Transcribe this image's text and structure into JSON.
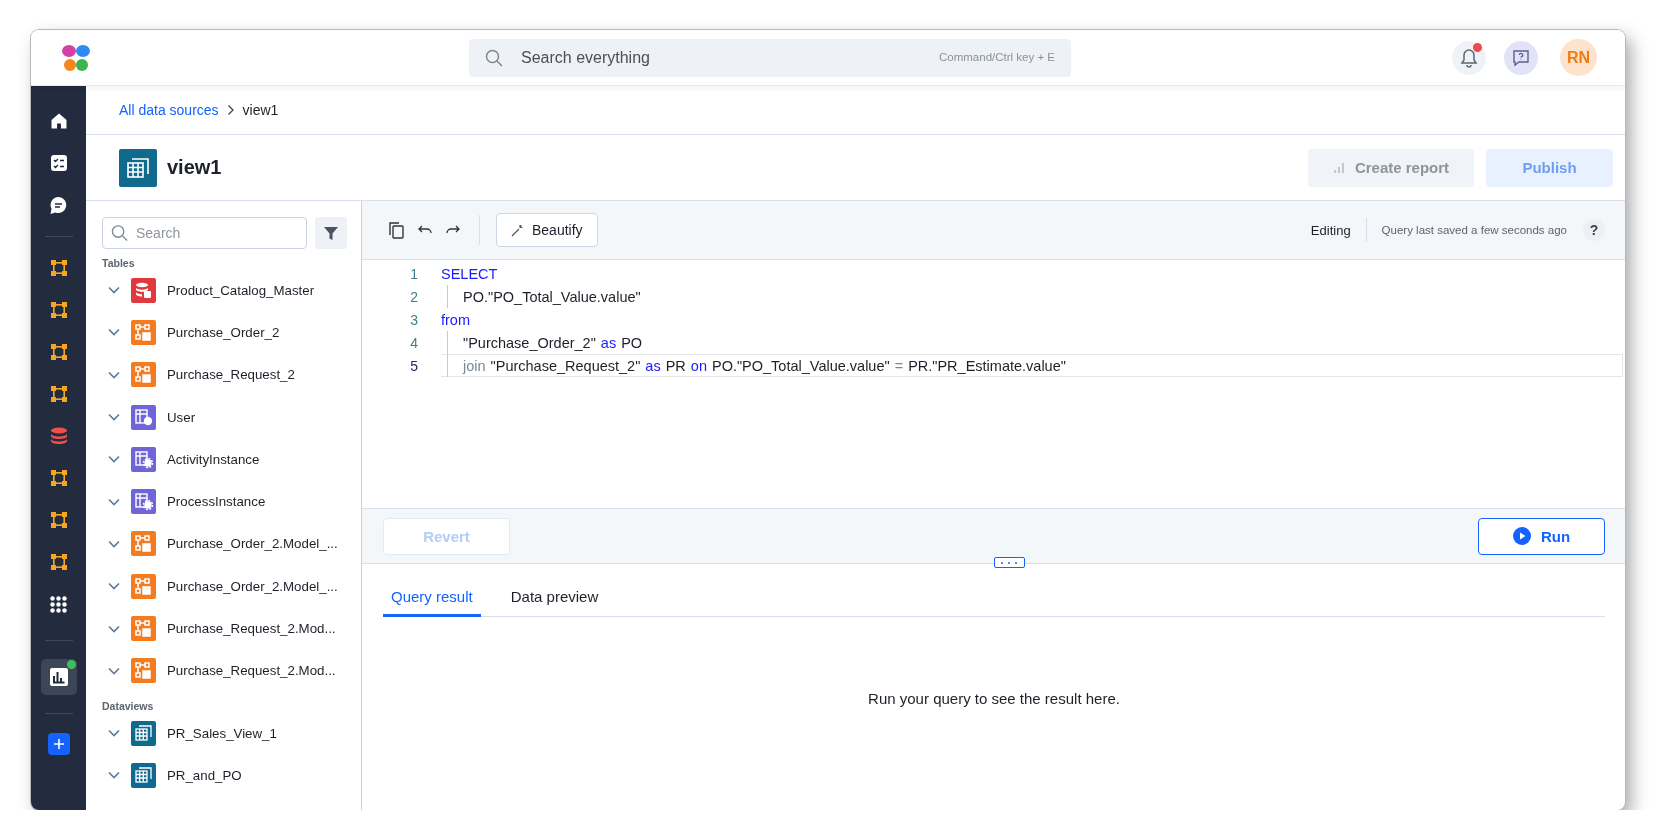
{
  "topbar": {
    "search": {
      "placeholder": "Search everything",
      "shortcut": "Command/Ctrl key + E"
    },
    "notifications": {
      "unread": true
    },
    "avatar": {
      "initials": "RN"
    }
  },
  "rail": [
    [
      {
        "kind": "home",
        "selected": false,
        "dot": false
      },
      {
        "kind": "tasks",
        "selected": false,
        "dot": false
      },
      {
        "kind": "chat",
        "selected": false,
        "dot": false
      }
    ],
    [
      {
        "kind": "model",
        "selected": false,
        "dot": false
      },
      {
        "kind": "model",
        "selected": false,
        "dot": false
      },
      {
        "kind": "model",
        "selected": false,
        "dot": false
      },
      {
        "kind": "model",
        "selected": false,
        "dot": false
      },
      {
        "kind": "database",
        "selected": false,
        "dot": false
      },
      {
        "kind": "model",
        "selected": false,
        "dot": false
      },
      {
        "kind": "model",
        "selected": false,
        "dot": false
      },
      {
        "kind": "model",
        "selected": false,
        "dot": false
      },
      {
        "kind": "apps",
        "selected": false,
        "dot": false
      }
    ],
    [
      {
        "kind": "analytics",
        "selected": true,
        "dot": true
      }
    ],
    [
      {
        "kind": "add",
        "selected": false,
        "dot": false
      }
    ]
  ],
  "breadcrumb": [
    {
      "label": "All data sources",
      "link": true
    },
    {
      "label": "view1",
      "link": false
    }
  ],
  "header": {
    "title": "view1",
    "buttons": [
      {
        "label": "Create report",
        "kind": "report",
        "disabled": true
      },
      {
        "label": "Publish",
        "kind": "primary",
        "disabled": true
      }
    ]
  },
  "sidebar": {
    "search": {
      "placeholder": "Search"
    },
    "groups": [
      {
        "title": "Tables",
        "items": [
          {
            "label": "Product_Catalog_Master",
            "kind": "database"
          },
          {
            "label": "Purchase_Order_2",
            "kind": "model"
          },
          {
            "label": "Purchase_Request_2",
            "kind": "model"
          },
          {
            "label": "User",
            "kind": "user"
          },
          {
            "label": "ActivityInstance",
            "kind": "process"
          },
          {
            "label": "ProcessInstance",
            "kind": "process"
          },
          {
            "label": "Purchase_Order_2.Model_...",
            "kind": "model"
          },
          {
            "label": "Purchase_Order_2.Model_...",
            "kind": "model"
          },
          {
            "label": "Purchase_Request_2.Mod...",
            "kind": "model"
          },
          {
            "label": "Purchase_Request_2.Mod...",
            "kind": "model"
          }
        ]
      },
      {
        "title": "Dataviews",
        "items": [
          {
            "label": "PR_Sales_View_1",
            "kind": "view"
          },
          {
            "label": "PR_and_PO",
            "kind": "view"
          }
        ]
      }
    ]
  },
  "editor": {
    "toolbar": {
      "beautify": "Beautify",
      "mode": "Editing",
      "saved": "Query last saved a few seconds ago",
      "help": "?"
    },
    "lines": [
      {
        "number": "1",
        "indented": false,
        "current": false,
        "tokens": [
          {
            "text": "SELECT",
            "kind": "keyword"
          }
        ]
      },
      {
        "number": "2",
        "indented": true,
        "current": false,
        "tokens": [
          {
            "text": "PO.\"PO_Total_Value.value\"",
            "kind": "text"
          }
        ]
      },
      {
        "number": "3",
        "indented": false,
        "current": false,
        "tokens": [
          {
            "text": "from",
            "kind": "keyword"
          }
        ]
      },
      {
        "number": "4",
        "indented": true,
        "current": false,
        "tokens": [
          {
            "text": "\"Purchase_Order_2\"",
            "kind": "text"
          },
          {
            "text": "as",
            "kind": "keyword"
          },
          {
            "text": "PO",
            "kind": "text"
          }
        ]
      },
      {
        "number": "5",
        "indented": true,
        "current": true,
        "tokens": [
          {
            "text": "join",
            "kind": "operator"
          },
          {
            "text": "\"Purchase_Request_2\"",
            "kind": "text"
          },
          {
            "text": "as",
            "kind": "keyword"
          },
          {
            "text": "PR",
            "kind": "text"
          },
          {
            "text": "on",
            "kind": "keyword"
          },
          {
            "text": "PO.\"PO_Total_Value.value\"",
            "kind": "text"
          },
          {
            "text": "=",
            "kind": "operator"
          },
          {
            "text": "PR.\"PR_Estimate.value\"",
            "kind": "text"
          }
        ]
      }
    ],
    "actions": [
      {
        "label": "Revert",
        "kind": "revert",
        "disabled": true
      },
      {
        "label": "Run",
        "kind": "run",
        "disabled": false
      }
    ]
  },
  "results": {
    "tabs": [
      {
        "label": "Query result",
        "selected": true
      },
      {
        "label": "Data preview",
        "selected": false
      }
    ],
    "empty": "Run your query to see the result here."
  }
}
